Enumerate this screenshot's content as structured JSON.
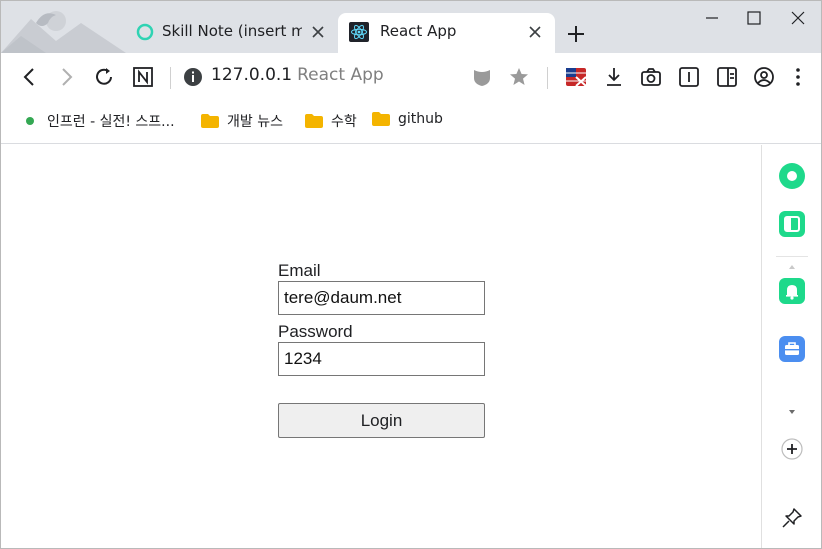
{
  "browser": {
    "tabs": [
      {
        "title": "Skill Note (insert mo",
        "active": false
      },
      {
        "title": "React App",
        "active": true
      }
    ],
    "url": {
      "host": "127.0.0.1",
      "page_title": "React App"
    },
    "bookmarks": [
      {
        "label": "인프런 - 실전! 스프...",
        "icon": "green-dot-icon"
      },
      {
        "label": "개발 뉴스",
        "icon": "folder-icon"
      },
      {
        "label": "수학",
        "icon": "folder-icon"
      },
      {
        "label": "github",
        "icon": "folder-icon"
      }
    ]
  },
  "form": {
    "email_label": "Email",
    "email_value": "tere@daum.net",
    "password_label": "Password",
    "password_value": "1234",
    "login_label": "Login"
  },
  "colors": {
    "tabstrip": "#dee1e6",
    "folder": "#f4b400",
    "sidepanel_green": "#1ed98b",
    "sidepanel_blue": "#4b8ef0"
  }
}
